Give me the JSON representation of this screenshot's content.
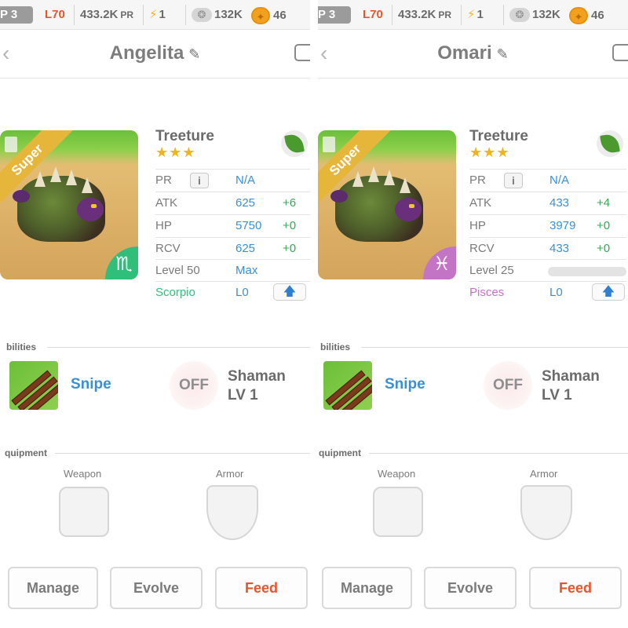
{
  "colors": {
    "level": "#e8542c",
    "stat_value": "#3a8fd8",
    "stat_bonus": "#3aa65a",
    "scorpio": "#2fbf7a",
    "pisces": "#c474c4",
    "feed": "#e8542c",
    "ribbon": "#e6b63b"
  },
  "panels": [
    {
      "status": {
        "vip": "P 3",
        "level": "L70",
        "pr": "433.2K",
        "pr_unit": "PR",
        "energy": "1",
        "energy_icon": "bolt-icon",
        "food": "132K",
        "food_icon": "paw-icon",
        "coins": "46",
        "coins_icon": "coin-icon"
      },
      "name": "Angelita",
      "monster": {
        "species": "Treeture",
        "stars": "★★★",
        "rarity": "Super",
        "element_icon": "leaf-icon",
        "zodiac_symbol": "♏",
        "zodiac_color": "#2fbf7a"
      },
      "stats": {
        "pr_label": "PR",
        "pr_info": "i",
        "pr_value": "N/A",
        "atk_label": "ATK",
        "atk_value": "625",
        "atk_bonus": "+6",
        "hp_label": "HP",
        "hp_value": "5750",
        "hp_bonus": "+0",
        "rcv_label": "RCV",
        "rcv_value": "625",
        "rcv_bonus": "+0",
        "level_label": "Level 50",
        "level_value": "Max",
        "zodiac_label": "Scorpio",
        "zodiac_level": "L0",
        "upgrade_icon": "up-arrow-icon"
      },
      "abilities": {
        "header": "bilities",
        "skill_name": "Snipe",
        "passive_state": "OFF",
        "passive_name": "Shaman",
        "passive_level": "LV 1"
      },
      "equipment": {
        "header": "quipment",
        "weapon_label": "Weapon",
        "armor_label": "Armor"
      },
      "buttons": {
        "manage": "Manage",
        "evolve": "Evolve",
        "feed": "Feed"
      }
    },
    {
      "status": {
        "vip": "P 3",
        "level": "L70",
        "pr": "433.2K",
        "pr_unit": "PR",
        "energy": "1",
        "energy_icon": "bolt-icon",
        "food": "132K",
        "food_icon": "paw-icon",
        "coins": "46",
        "coins_icon": "coin-icon"
      },
      "name": "Omari",
      "monster": {
        "species": "Treeture",
        "stars": "★★★",
        "rarity": "Super",
        "element_icon": "leaf-icon",
        "zodiac_symbol": "♓",
        "zodiac_color": "#c474c4"
      },
      "stats": {
        "pr_label": "PR",
        "pr_info": "i",
        "pr_value": "N/A",
        "atk_label": "ATK",
        "atk_value": "433",
        "atk_bonus": "+4",
        "hp_label": "HP",
        "hp_value": "3979",
        "hp_bonus": "+0",
        "rcv_label": "RCV",
        "rcv_value": "433",
        "rcv_bonus": "+0",
        "level_label": "Level 25",
        "xp_progress": 0,
        "zodiac_label": "Pisces",
        "zodiac_level": "L0",
        "upgrade_icon": "up-arrow-icon"
      },
      "abilities": {
        "header": "bilities",
        "skill_name": "Snipe",
        "passive_state": "OFF",
        "passive_name": "Shaman",
        "passive_level": "LV 1"
      },
      "equipment": {
        "header": "quipment",
        "weapon_label": "Weapon",
        "armor_label": "Armor"
      },
      "buttons": {
        "manage": "Manage",
        "evolve": "Evolve",
        "feed": "Feed"
      }
    }
  ]
}
